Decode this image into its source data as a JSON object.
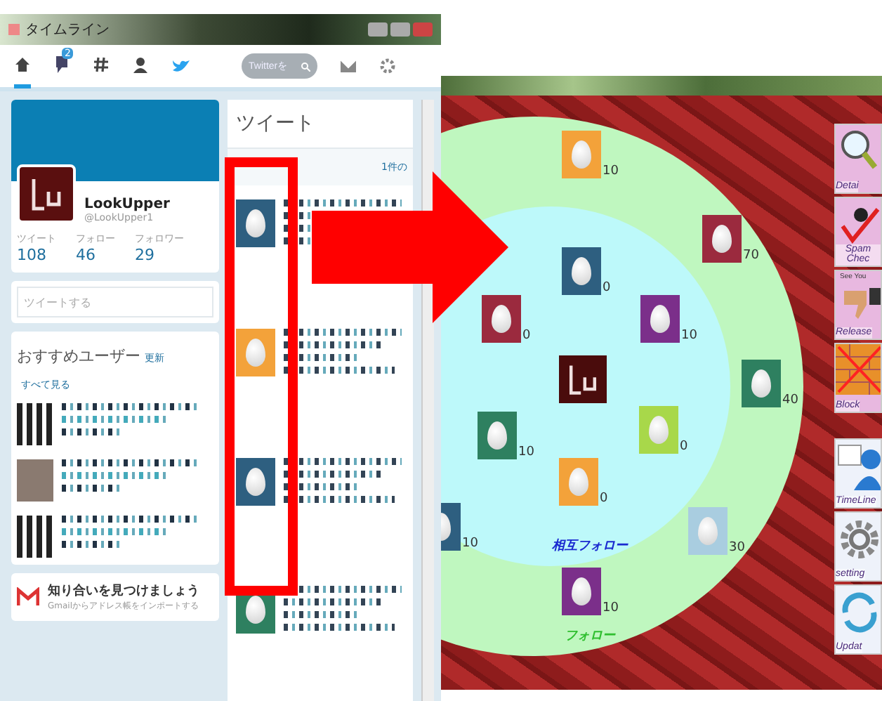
{
  "timeline_window": {
    "title": "タイムライン",
    "nav_tabs": [
      {
        "kind": "home",
        "selected": true
      },
      {
        "kind": "notifications",
        "badge": "2",
        "selected": false
      },
      {
        "kind": "hashtag",
        "selected": false
      },
      {
        "kind": "profile",
        "selected": false
      }
    ],
    "search": {
      "placeholder": "Twitterを"
    },
    "profile": {
      "name": "LookUpper",
      "handle": "@LookUpper1",
      "stats": [
        {
          "label": "ツイート",
          "value": "108"
        },
        {
          "label": "フォロー",
          "value": "46"
        },
        {
          "label": "フォロワー",
          "value": "29"
        }
      ]
    },
    "compose": {
      "placeholder": "ツイートする"
    },
    "recommended": {
      "title": "おすすめユーザー",
      "links": [
        "更新",
        "すべて見る"
      ],
      "users": [
        {
          "kind": "pixel"
        },
        {
          "kind": "photo"
        },
        {
          "kind": "pixel"
        }
      ]
    },
    "gmail": {
      "title": "知り合いを見つけましょう",
      "subtitle": "Gmailからアドレス帳をインポートする"
    },
    "tweets": {
      "title": "ツイート",
      "new_count": "1件の",
      "items": [
        {
          "color": "#2e5f80"
        },
        {
          "color": "#f3a23a"
        },
        {
          "color": "#2e5f80"
        },
        {
          "color": "#2e8060"
        }
      ]
    }
  },
  "graph_window": {
    "nodes": [
      {
        "color": "#f3a23a",
        "count": "10"
      },
      {
        "color": "#9b2a3e",
        "count": "70"
      },
      {
        "color": "#2e5f80",
        "count": "0"
      },
      {
        "color": "#9b2a3e",
        "count": "0"
      },
      {
        "color": "#7b2f8a",
        "count": "10"
      },
      {
        "color": "#2e8060",
        "count": "40"
      },
      {
        "color": "#2e8060",
        "count": "10"
      },
      {
        "color": "#a8d84a",
        "count": "0"
      },
      {
        "color": "#f3a23a",
        "count": "0"
      },
      {
        "color": "#2e5f80",
        "count": "10"
      },
      {
        "color": "#a9cde0",
        "count": "30"
      },
      {
        "color": "#7b2f8a",
        "count": "10"
      }
    ],
    "ring_labels": [
      {
        "kind": "mutual",
        "text": "相互フォロー"
      },
      {
        "kind": "follow",
        "text": "フォロー"
      }
    ],
    "tools": [
      {
        "kind": "detail",
        "label": "Detai"
      },
      {
        "kind": "spam",
        "label": "Spam Chec"
      },
      {
        "kind": "release",
        "label": "Release",
        "note": "See You"
      },
      {
        "kind": "block",
        "label": "Block"
      },
      {
        "kind": "timeline",
        "label": "TimeLine"
      },
      {
        "kind": "setting",
        "label": "setting"
      },
      {
        "kind": "update",
        "label": "Updat"
      }
    ]
  }
}
